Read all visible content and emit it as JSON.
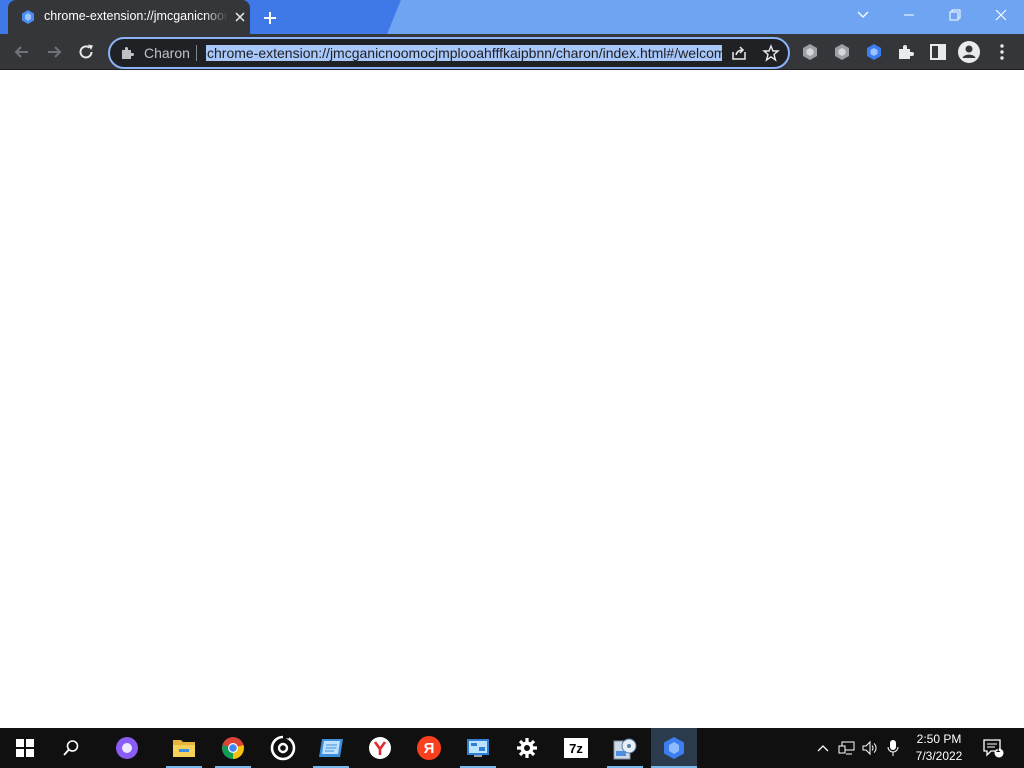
{
  "browser": {
    "tab": {
      "title": "chrome-extension://jmcganicnoomocjmplooahfffkaipbnn/charon/index.html#/welcome",
      "favicon": "charon-extension-icon"
    },
    "new_tab_icon": "plus-icon",
    "window_controls": [
      "chevron-down-icon",
      "minimize-icon",
      "restore-icon",
      "close-icon"
    ],
    "omnibox": {
      "chip_label": "Charon",
      "url": "chrome-extension://jmcganicnoomocjmplooahfffkaipbnn/charon/index.html#/welcome",
      "selected": true
    },
    "toolbar_icons": [
      "extension-gray-hex-icon",
      "extension-gray-hex-icon",
      "charon-extension-icon",
      "extensions-puzzle-icon",
      "side-panel-icon",
      "profile-avatar-icon",
      "more-menu-icon"
    ]
  },
  "page": {
    "content": ""
  },
  "taskbar": {
    "apps": [
      "start-icon",
      "search-icon",
      "alice-assistant-icon",
      "file-explorer-icon",
      "chrome-icon",
      "groove-icon",
      "notepad-icon",
      "yandex-browser-icon",
      "yandex-icon",
      "control-panel-icon",
      "settings-gear-icon",
      "7zip-icon",
      "disk-tool-icon",
      "charon-extension-icon"
    ],
    "labels": {
      "yandex_letter": "Я",
      "sevenzip": "7z"
    },
    "tray": {
      "icons": [
        "chevron-up-icon",
        "network-icon",
        "volume-icon",
        "microphone-icon"
      ],
      "time": "2:50 PM",
      "date": "7/3/2022",
      "notification_count": "1"
    }
  },
  "colors": {
    "titlebar": "#3f79e8",
    "titlebar_light": "#6ea4f2",
    "toolbar": "#35363a",
    "selection": "#a8c7fa",
    "focus_ring": "#8ab4f8",
    "taskbar": "#101010"
  }
}
